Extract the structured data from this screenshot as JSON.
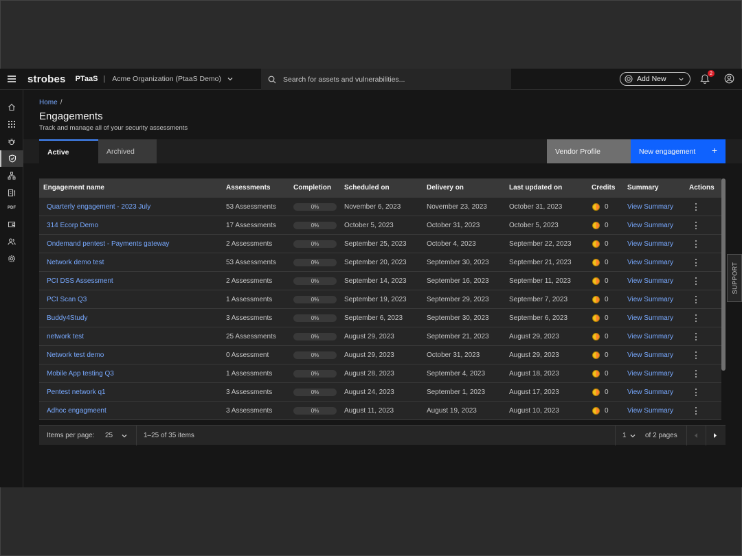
{
  "header": {
    "logo": "strobes",
    "product": "PTaaS",
    "separator": "|",
    "org": "Acme Organization (PtaaS Demo)",
    "search_placeholder": "Search for assets and vulnerabilities...",
    "add_new": "Add New",
    "notification_count": "2"
  },
  "breadcrumb": {
    "home": "Home",
    "slash": "/"
  },
  "page": {
    "title": "Engagements",
    "subtitle": "Track and manage all of your security assessments"
  },
  "tabs": {
    "active": "Active",
    "archived": "Archived"
  },
  "buttons": {
    "vendor_profile": "Vendor Profile",
    "new_engagement": "New engagement",
    "plus": "+"
  },
  "table": {
    "headers": {
      "name": "Engagement name",
      "assessments": "Assessments",
      "completion": "Completion",
      "scheduled": "Scheduled on",
      "delivery": "Delivery on",
      "updated": "Last updated on",
      "credits": "Credits",
      "summary": "Summary",
      "actions": "Actions"
    },
    "rows": [
      {
        "name": "Quarterly engagement - 2023 July",
        "assessments": "53 Assessments",
        "completion": "0%",
        "scheduled": "November 6, 2023",
        "delivery": "November 23, 2023",
        "updated": "October 31, 2023",
        "credits": "0",
        "summary": "View Summary"
      },
      {
        "name": "314 Ecorp Demo",
        "assessments": "17 Assessments",
        "completion": "0%",
        "scheduled": "October 5, 2023",
        "delivery": "October 31, 2023",
        "updated": "October 5, 2023",
        "credits": "0",
        "summary": "View Summary"
      },
      {
        "name": "Ondemand pentest - Payments gateway",
        "assessments": "2 Assessments",
        "completion": "0%",
        "scheduled": "September 25, 2023",
        "delivery": "October 4, 2023",
        "updated": "September 22, 2023",
        "credits": "0",
        "summary": "View Summary"
      },
      {
        "name": "Network demo test",
        "assessments": "53 Assessments",
        "completion": "0%",
        "scheduled": "September 20, 2023",
        "delivery": "September 30, 2023",
        "updated": "September 21, 2023",
        "credits": "0",
        "summary": "View Summary"
      },
      {
        "name": "PCI DSS Assessment",
        "assessments": "2 Assessments",
        "completion": "0%",
        "scheduled": "September 14, 2023",
        "delivery": "September 16, 2023",
        "updated": "September 11, 2023",
        "credits": "0",
        "summary": "View Summary"
      },
      {
        "name": "PCI Scan Q3",
        "assessments": "1 Assessments",
        "completion": "0%",
        "scheduled": "September 19, 2023",
        "delivery": "September 29, 2023",
        "updated": "September 7, 2023",
        "credits": "0",
        "summary": "View Summary"
      },
      {
        "name": "Buddy4Study",
        "assessments": "3 Assessments",
        "completion": "0%",
        "scheduled": "September 6, 2023",
        "delivery": "September 30, 2023",
        "updated": "September 6, 2023",
        "credits": "0",
        "summary": "View Summary"
      },
      {
        "name": "network test",
        "assessments": "25 Assessments",
        "completion": "0%",
        "scheduled": "August 29, 2023",
        "delivery": "September 21, 2023",
        "updated": "August 29, 2023",
        "credits": "0",
        "summary": "View Summary"
      },
      {
        "name": "Network test demo",
        "assessments": "0 Assessment",
        "completion": "0%",
        "scheduled": "August 29, 2023",
        "delivery": "October 31, 2023",
        "updated": "August 29, 2023",
        "credits": "0",
        "summary": "View Summary"
      },
      {
        "name": "Mobile App testing Q3",
        "assessments": "1 Assessments",
        "completion": "0%",
        "scheduled": "August 28, 2023",
        "delivery": "September 4, 2023",
        "updated": "August 18, 2023",
        "credits": "0",
        "summary": "View Summary"
      },
      {
        "name": "Pentest network q1",
        "assessments": "3 Assessments",
        "completion": "0%",
        "scheduled": "August 24, 2023",
        "delivery": "September 1, 2023",
        "updated": "August 17, 2023",
        "credits": "0",
        "summary": "View Summary"
      },
      {
        "name": "Adhoc engagmeent",
        "assessments": "3 Assessments",
        "completion": "0%",
        "scheduled": "August 11, 2023",
        "delivery": "August 19, 2023",
        "updated": "August 10, 2023",
        "credits": "0",
        "summary": "View Summary"
      }
    ]
  },
  "pagination": {
    "items_per_page_label": "Items per page:",
    "items_per_page": "25",
    "range": "1–25 of 35 items",
    "page": "1",
    "of_pages": "of 2 pages"
  },
  "support": "SUPPORT",
  "sidebar": {
    "pdf_label": "PDF"
  }
}
